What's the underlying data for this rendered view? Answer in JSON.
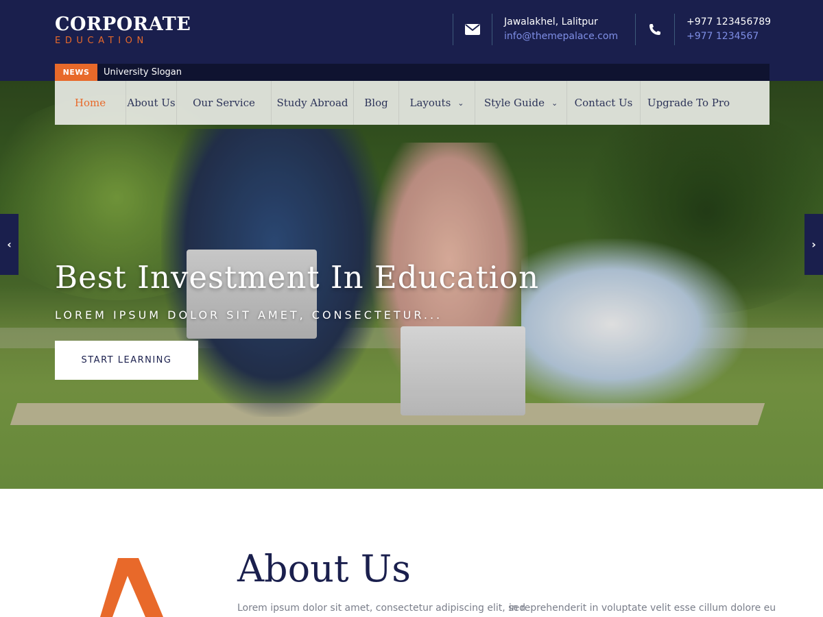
{
  "header": {
    "logo_main": "CORPORATE",
    "logo_sub": "EDUCATION",
    "email_icon": "envelope-icon",
    "phone_icon": "phone-icon",
    "address": "Jawalakhel, Lalitpur",
    "email": "info@themepalace.com",
    "phone1": "+977 123456789",
    "phone2": "+977 1234567",
    "news_label": "NEWS",
    "news_text": "University Slogan"
  },
  "nav": {
    "items": [
      {
        "label": "Home",
        "active": true
      },
      {
        "label": "About Us"
      },
      {
        "label": "Our Service"
      },
      {
        "label": "Study Abroad"
      },
      {
        "label": "Blog"
      },
      {
        "label": "Layouts",
        "dropdown": true
      },
      {
        "label": "Style Guide",
        "dropdown": true
      },
      {
        "label": "Contact Us"
      },
      {
        "label": "Upgrade To Pro"
      }
    ]
  },
  "hero": {
    "title": "Best Investment In Education",
    "subtitle": "LOREM IPSUM DOLOR SIT AMET, CONSECTETUR...",
    "button": "START LEARNING",
    "prev_icon": "chevron-left-icon",
    "next_icon": "chevron-right-icon"
  },
  "about": {
    "title": "About Us",
    "text_col1": "Lorem ipsum dolor sit amet, consectetur adipiscing elit, sed",
    "text_col2": "in reprehenderit in voluptate velit esse cillum dolore eu"
  },
  "colors": {
    "navy": "#1a1f4d",
    "accent": "#e8692a",
    "link": "#7f8fe6"
  }
}
